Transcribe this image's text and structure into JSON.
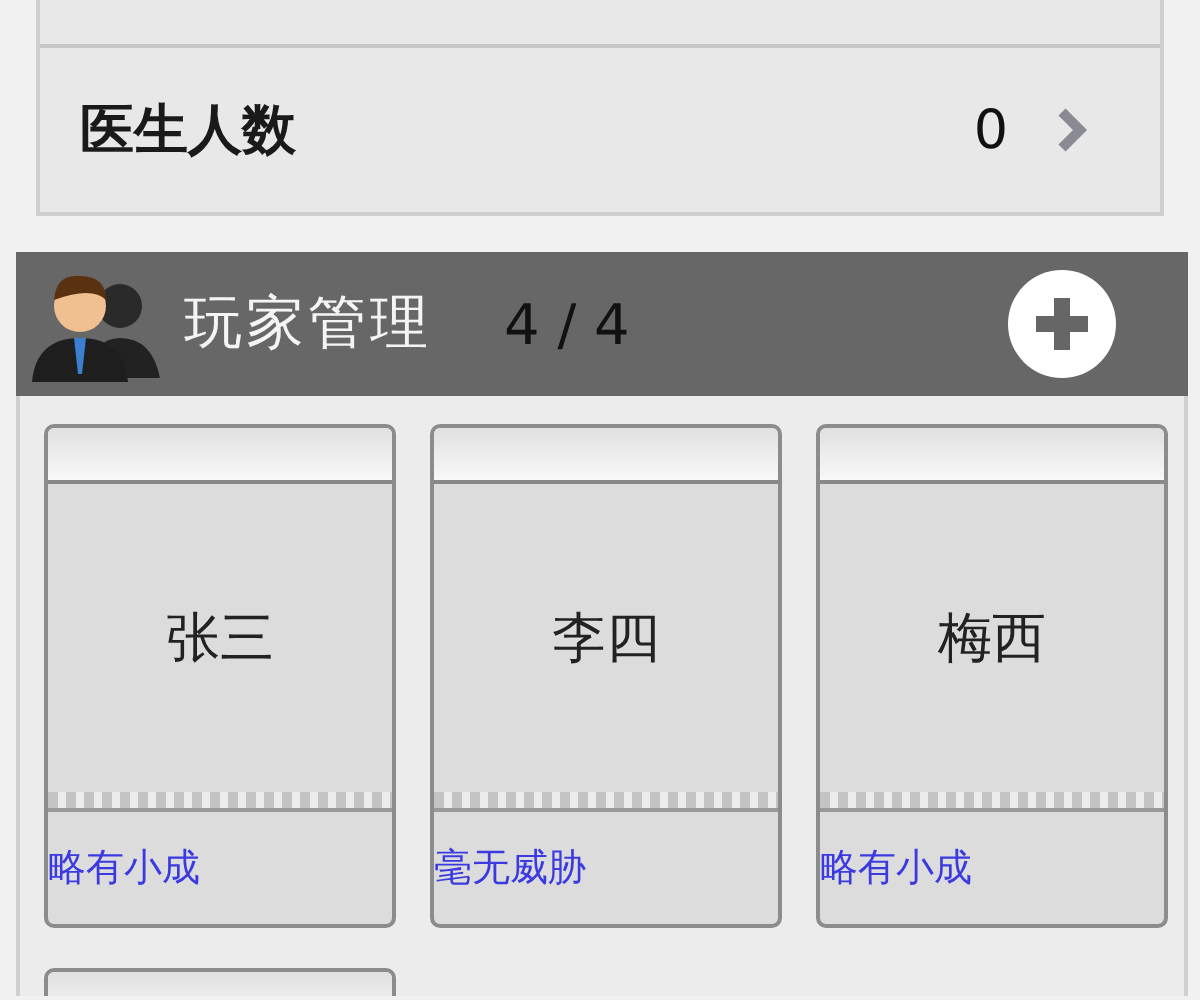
{
  "stats": [
    {
      "kind": "cut"
    },
    {
      "label": "医生人数",
      "value": "0",
      "kind": "link"
    }
  ],
  "players_header": {
    "title": "玩家管理",
    "count": "4 / 4"
  },
  "players": [
    {
      "name": "张三",
      "rank": "略有小成"
    },
    {
      "name": "李四",
      "rank": "毫无威胁"
    },
    {
      "name": "梅西",
      "rank": "略有小成"
    }
  ],
  "partial_card": true
}
